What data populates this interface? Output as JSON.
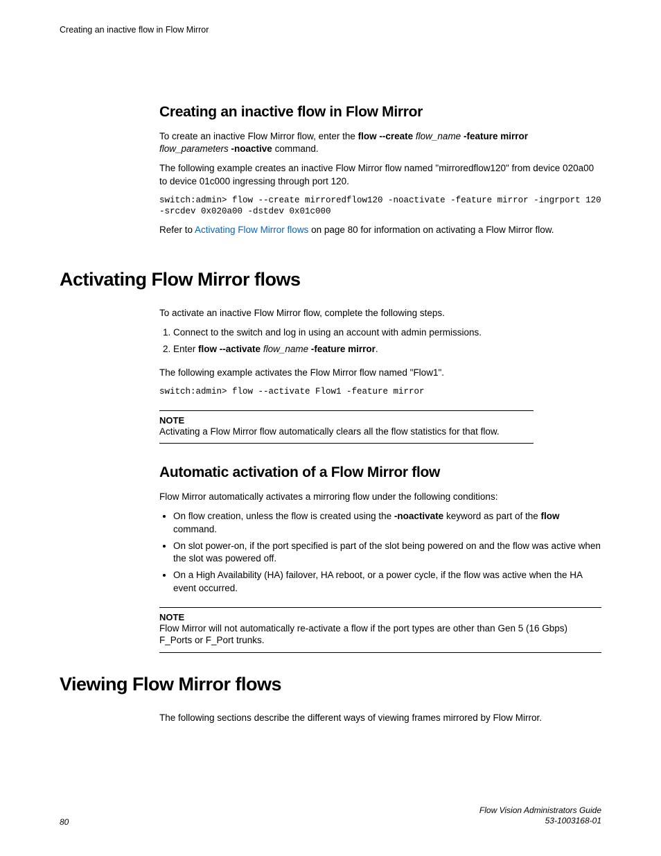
{
  "running_head": "Creating an inactive flow in Flow Mirror",
  "s1": {
    "heading": "Creating an inactive flow in Flow Mirror",
    "p1_a": "To create an inactive Flow Mirror flow, enter the ",
    "p1_cmd1": "flow --create",
    "p1_flowname": " flow_name ",
    "p1_cmd2": "-feature mirror",
    "p1_flowparams": "flow_parameters ",
    "p1_cmd3": "-noactive",
    "p1_end": " command.",
    "p2": "The following example creates an inactive Flow Mirror flow named \"mirroredflow120\" from device 020a00 to device 01c000 ingressing through port 120.",
    "code": "switch:admin> flow --create mirroredflow120 -noactivate -feature mirror -ingrport 120 -srcdev 0x020a00 -dstdev 0x01c000",
    "p3_a": "Refer to ",
    "p3_link": "Activating Flow Mirror flows",
    "p3_b": " on page 80 for information on activating a Flow Mirror flow."
  },
  "s2": {
    "heading": "Activating Flow Mirror flows",
    "p1": "To activate an inactive Flow Mirror flow, complete the following steps.",
    "step1": "Connect to the switch and log in using an account with admin permissions.",
    "step2_a": "Enter ",
    "step2_cmd1": "flow --activate",
    "step2_flowname": " flow_name ",
    "step2_cmd2": "-feature mirror",
    "step2_end": ".",
    "p2": "The following example activates the Flow Mirror flow named \"Flow1\".",
    "code": "switch:admin> flow --activate Flow1 -feature mirror",
    "note_label": "NOTE",
    "note_body": "Activating a Flow Mirror flow automatically clears all the flow statistics for that flow."
  },
  "s3": {
    "heading": "Automatic activation of a Flow Mirror flow",
    "p1": "Flow Mirror automatically activates a mirroring flow under the following conditions:",
    "b1_a": "On flow creation, unless the flow is created using the ",
    "b1_kw1": "-noactivate",
    "b1_b": " keyword as part of the ",
    "b1_kw2": "flow",
    "b1_c": " command.",
    "b2": "On slot power-on, if the port specified is part of the slot being powered on and the flow was active when the slot was powered off.",
    "b3": "On a High Availability (HA) failover, HA reboot, or a power cycle, if the flow was active when the HA event occurred.",
    "note_label": "NOTE",
    "note_body": "Flow Mirror will not automatically re-activate a flow if the port types are other than Gen 5 (16 Gbps) F_Ports or F_Port trunks."
  },
  "s4": {
    "heading": "Viewing Flow Mirror flows",
    "p1": "The following sections describe the different ways of viewing frames mirrored by Flow Mirror."
  },
  "footer": {
    "page": "80",
    "title": "Flow Vision Administrators Guide",
    "docnum": "53-1003168-01"
  }
}
